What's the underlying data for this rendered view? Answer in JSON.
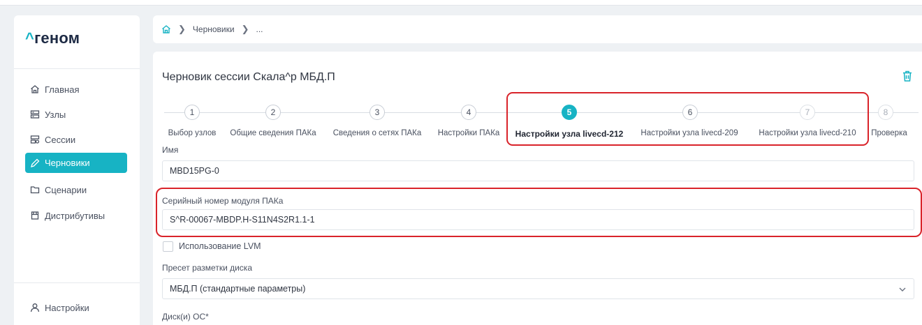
{
  "brand": {
    "logo_caret": "^",
    "logo_text": "геном",
    "accent": "#17b3c4"
  },
  "sidebar": {
    "items": [
      {
        "label": "Главная",
        "icon": "home-icon"
      },
      {
        "label": "Узлы",
        "icon": "server-icon"
      },
      {
        "label": "Сессии",
        "icon": "sessions-icon"
      },
      {
        "label": "Черновики",
        "icon": "pencil-icon",
        "active": true
      },
      {
        "label": "Сценарии",
        "icon": "folder-icon"
      },
      {
        "label": "Дистрибутивы",
        "icon": "package-icon"
      }
    ],
    "settings_label": "Настройки"
  },
  "breadcrumb": {
    "items": [
      "Черновики",
      "..."
    ]
  },
  "page": {
    "title": "Черновик сессии Скала^р МБД.П"
  },
  "stepper": {
    "steps": [
      {
        "number": "1",
        "label": "Выбор узлов"
      },
      {
        "number": "2",
        "label": "Общие сведения ПАКа"
      },
      {
        "number": "3",
        "label": "Сведения о сетях ПАКа"
      },
      {
        "number": "4",
        "label": "Настройки ПАКа"
      },
      {
        "number": "5",
        "label": "Настройки узла livecd-212",
        "active": true
      },
      {
        "number": "6",
        "label": "Настройки узла livecd-209"
      },
      {
        "number": "7",
        "label": "Настройки узла livecd-210"
      },
      {
        "number": "8",
        "label": "Проверка"
      }
    ]
  },
  "form": {
    "name_label": "Имя",
    "name_value": "MBD15PG-0",
    "serial_label": "Серийный номер модуля ПАКа",
    "serial_value": "S^R-00067-MBDP.H-S11N4S2R1.1-1",
    "lvm_label": "Использование LVM",
    "lvm_checked": false,
    "preset_label": "Пресет разметки диска",
    "preset_value": "МБД.П (стандартные параметры)",
    "disk_label": "Диск(и) ОС*"
  },
  "colors": {
    "highlight": "#d9232a",
    "accent": "#17b3c4"
  }
}
